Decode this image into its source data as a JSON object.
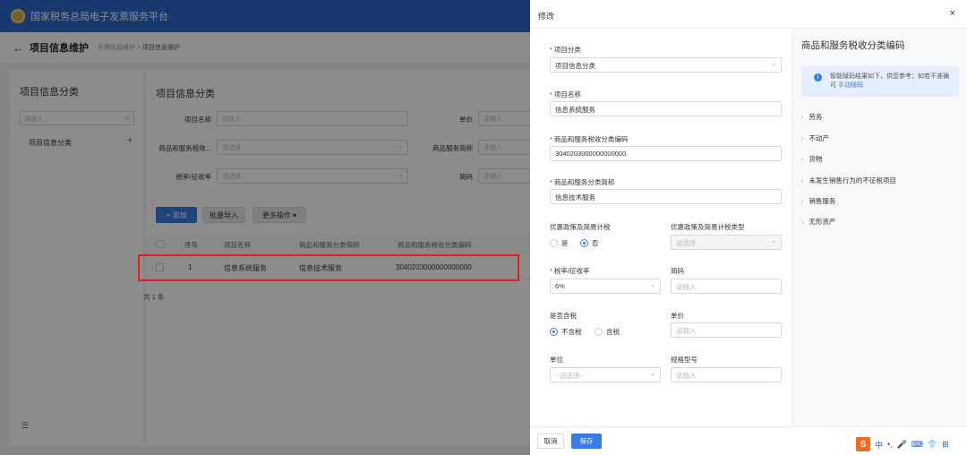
{
  "app": {
    "brand": "国家税务总局电子发票服务平台",
    "back_icon": "arrow-left-icon",
    "page_title": "项目信息维护",
    "breadcrumb": [
      "开票信息维护",
      "项目信息维护"
    ],
    "breadcrumb_sep": ">"
  },
  "left": {
    "title": "项目信息分类",
    "search_placeholder": "请输入",
    "tree_item": "项目信息分类",
    "plus": "+",
    "collapse_glyph": "☰"
  },
  "main": {
    "title": "项目信息分类",
    "filters": {
      "name_label": "项目名称",
      "name_placeholder": "请输入",
      "price_label": "单价",
      "price_placeholder": "请输入",
      "taxcode_label": "商品和服务税收...",
      "taxcode_placeholder": "请选择",
      "short_label": "商品服务简称",
      "short_placeholder": "请输入",
      "rate_label": "税率/征收率",
      "rate_placeholder": "请选择",
      "abbr_label": "简码",
      "abbr_placeholder": "请输入"
    },
    "toolbar": {
      "add_label": "+ 添加",
      "import_label": "批量导入",
      "more_label": "更多操作 ▾"
    },
    "table": {
      "headers": [
        "序号",
        "项目名称",
        "商品和服务分类简称",
        "商品和服务税收分类编码"
      ],
      "rows": [
        {
          "index": "1",
          "name": "信息系统服务",
          "short": "信息技术服务",
          "code": "3040203000000000000"
        }
      ]
    },
    "count_text": "共 1 条"
  },
  "drawer": {
    "title": "修改",
    "close": "×",
    "fields": {
      "category_label": "项目分类",
      "category_value": "项目信息分类",
      "name_label": "项目名称",
      "name_value": "信息系统服务",
      "code_label": "商品和服务税收分类编码",
      "code_value": "3040203000000000000",
      "short_label": "商品和服务分类简称",
      "short_value": "信息技术服务",
      "policy_label": "优惠政策及简易计税",
      "policy_yes": "是",
      "policy_no": "否",
      "policy_type_label": "优惠政策及简易计税类型",
      "policy_type_placeholder": "请选择",
      "rate_label": "税率/征收率",
      "rate_value": "6%",
      "abbr_label": "简码",
      "abbr_placeholder": "请输入",
      "taxinc_label": "是否含税",
      "taxinc_no": "不含税",
      "taxinc_yes": "含税",
      "price_label": "单价",
      "price_placeholder": "请输入",
      "unit_label": "单位",
      "unit_placeholder": "--请选择--",
      "spec_label": "规格型号",
      "spec_placeholder": "请输入"
    },
    "side": {
      "title": "商品和服务税收分类编码",
      "tip_text": "智能赋码结果如下，供您参考；如若不准确可",
      "tip_link": "手动赋码",
      "categories": [
        "劳务",
        "不动产",
        "货物",
        "未发生销售行为的不征税项目",
        "销售服务",
        "无形资产"
      ]
    },
    "footer": {
      "cancel_label": "取消",
      "save_label": "保存"
    },
    "ime": {
      "logo": "S",
      "lang": "中",
      "punct": "•,",
      "mic": "🎤",
      "kbd": "⌨",
      "shirt": "👕",
      "grid": "⊞"
    }
  },
  "colors": {
    "primary": "#3a7be0",
    "topbar": "#2a68c9",
    "highlight": "#e02020"
  }
}
